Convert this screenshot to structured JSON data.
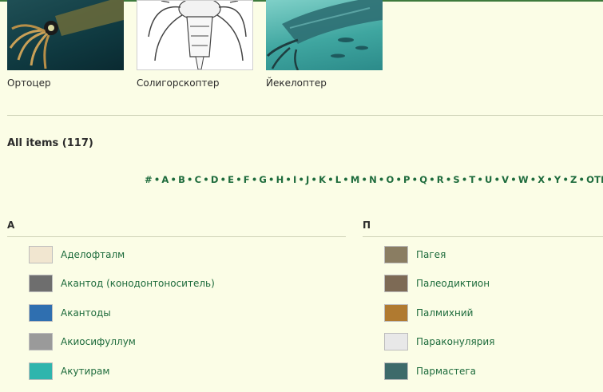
{
  "gallery": [
    {
      "caption": "Ортоцер"
    },
    {
      "caption": "Солигорскоптер"
    },
    {
      "caption": "Йекелоптер"
    }
  ],
  "all_items_heading": "All items (117)",
  "alphabet": [
    "#",
    "A",
    "B",
    "C",
    "D",
    "E",
    "F",
    "G",
    "H",
    "I",
    "J",
    "K",
    "L",
    "M",
    "N",
    "O",
    "P",
    "Q",
    "R",
    "S",
    "T",
    "U",
    "V",
    "W",
    "X",
    "Y",
    "Z",
    "OTHER"
  ],
  "columns": [
    {
      "header": "А",
      "items": [
        {
          "label": "Аделофталм",
          "thumb_color": "#f1e6d0"
        },
        {
          "label": "Акантод (конодонтоноситель)",
          "thumb_color": "#6e6e6e"
        },
        {
          "label": "Акантоды",
          "thumb_color": "#2f6fb0"
        },
        {
          "label": "Акиосифуллум",
          "thumb_color": "#9a9a9a"
        },
        {
          "label": "Акутирам",
          "thumb_color": "#2fb5ad"
        }
      ]
    },
    {
      "header": "П",
      "items": [
        {
          "label": "Пагея",
          "thumb_color": "#8a7d62"
        },
        {
          "label": "Палеодиктион",
          "thumb_color": "#7d6a55"
        },
        {
          "label": "Палмихний",
          "thumb_color": "#b07a30"
        },
        {
          "label": "Параконулярия",
          "thumb_color": "#e8e8e8"
        },
        {
          "label": "Пармастега",
          "thumb_color": "#3d6a6a"
        }
      ]
    }
  ]
}
